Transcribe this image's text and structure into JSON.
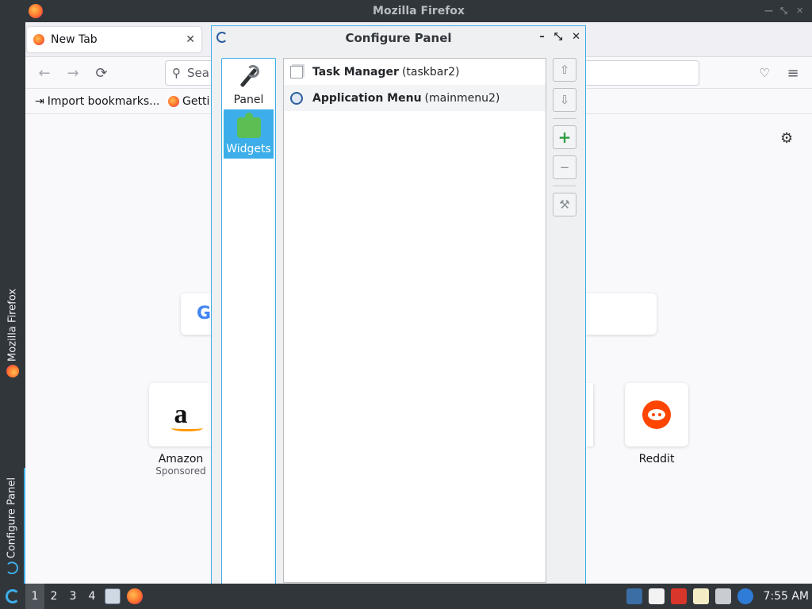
{
  "firefox": {
    "window_title": "Mozilla Firefox",
    "tab": {
      "label": "New Tab",
      "close": "✕"
    },
    "nav": {
      "back": "←",
      "forward": "→",
      "reload": "⟳"
    },
    "urlbar": {
      "placeholder": "Sea"
    },
    "bookmarks": [
      {
        "label": "Import bookmarks..."
      },
      {
        "label": "Getti"
      }
    ],
    "page": {
      "search_g": "G",
      "shortcuts": [
        {
          "name": "Amazon",
          "sub": "Sponsored"
        },
        {
          "name": "Reddit",
          "sub": ""
        }
      ]
    }
  },
  "left_strip": {
    "tasks": [
      {
        "label": "Mozilla Firefox"
      },
      {
        "label": "Configure Panel"
      }
    ]
  },
  "dialog": {
    "title": "Configure Panel",
    "controls": {
      "minimize": "–",
      "maximize": "⤡",
      "close": "✕"
    },
    "categories": [
      {
        "label": "Panel",
        "icon": "wrench-icon"
      },
      {
        "label": "Widgets",
        "icon": "puzzle-icon",
        "selected": true
      }
    ],
    "widgets": [
      {
        "name": "Task Manager",
        "id": "(taskbar2)",
        "icon": "task-manager-icon"
      },
      {
        "name": "Application Menu",
        "id": "(mainmenu2)",
        "icon": "application-menu-icon"
      }
    ],
    "buttons": {
      "up": "⇧",
      "down": "⇩",
      "add": "+",
      "remove": "−",
      "configure": "⚒"
    }
  },
  "taskbar": {
    "desktops": [
      "1",
      "2",
      "3",
      "4"
    ],
    "active_desktop": "1",
    "clock": "7:55 AM"
  },
  "colors": {
    "accent": "#3daee9",
    "panel_bg": "#31363b",
    "dialog_bg": "#eff0f1"
  }
}
